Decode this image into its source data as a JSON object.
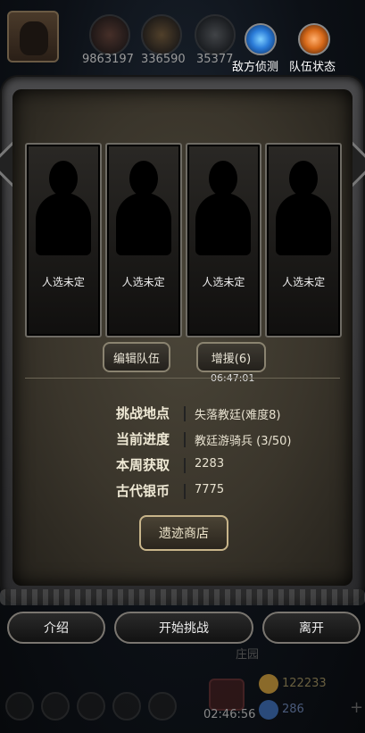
{
  "top_bar": {
    "resources": [
      {
        "icon": "sword-orb-icon",
        "value": "9863197"
      },
      {
        "icon": "scroll-orb-icon",
        "value": "336590"
      },
      {
        "icon": "gear-orb-icon",
        "value": "35377"
      }
    ],
    "enemy_scout_label": "敌方侦测",
    "team_status_label": "队伍状态"
  },
  "panel": {
    "slots": [
      {
        "label": "人选未定"
      },
      {
        "label": "人选未定"
      },
      {
        "label": "人选未定"
      },
      {
        "label": "人选未定"
      }
    ],
    "edit_team_label": "编辑队伍",
    "reinforce_label": "增援(6)",
    "reinforce_timer": "06:47:01",
    "info": [
      {
        "key": "挑战地点",
        "value": "失落教廷(难度8)"
      },
      {
        "key": "当前进度",
        "value": "教廷游骑兵 (3/50)"
      },
      {
        "key": "本周获取",
        "value": "2283"
      },
      {
        "key": "古代银币",
        "value": "7775"
      }
    ],
    "shop_label": "遗迹商店"
  },
  "bottom": {
    "intro_label": "介绍",
    "start_label": "开始挑战",
    "leave_label": "离开",
    "manor_label": "庄园",
    "timer": "02:46:56",
    "gold": "122233",
    "gems": "286"
  },
  "colors": {
    "accent_blue": "#2a7bd8",
    "accent_orange": "#d86a1a",
    "frame": "#4a4a4c"
  }
}
